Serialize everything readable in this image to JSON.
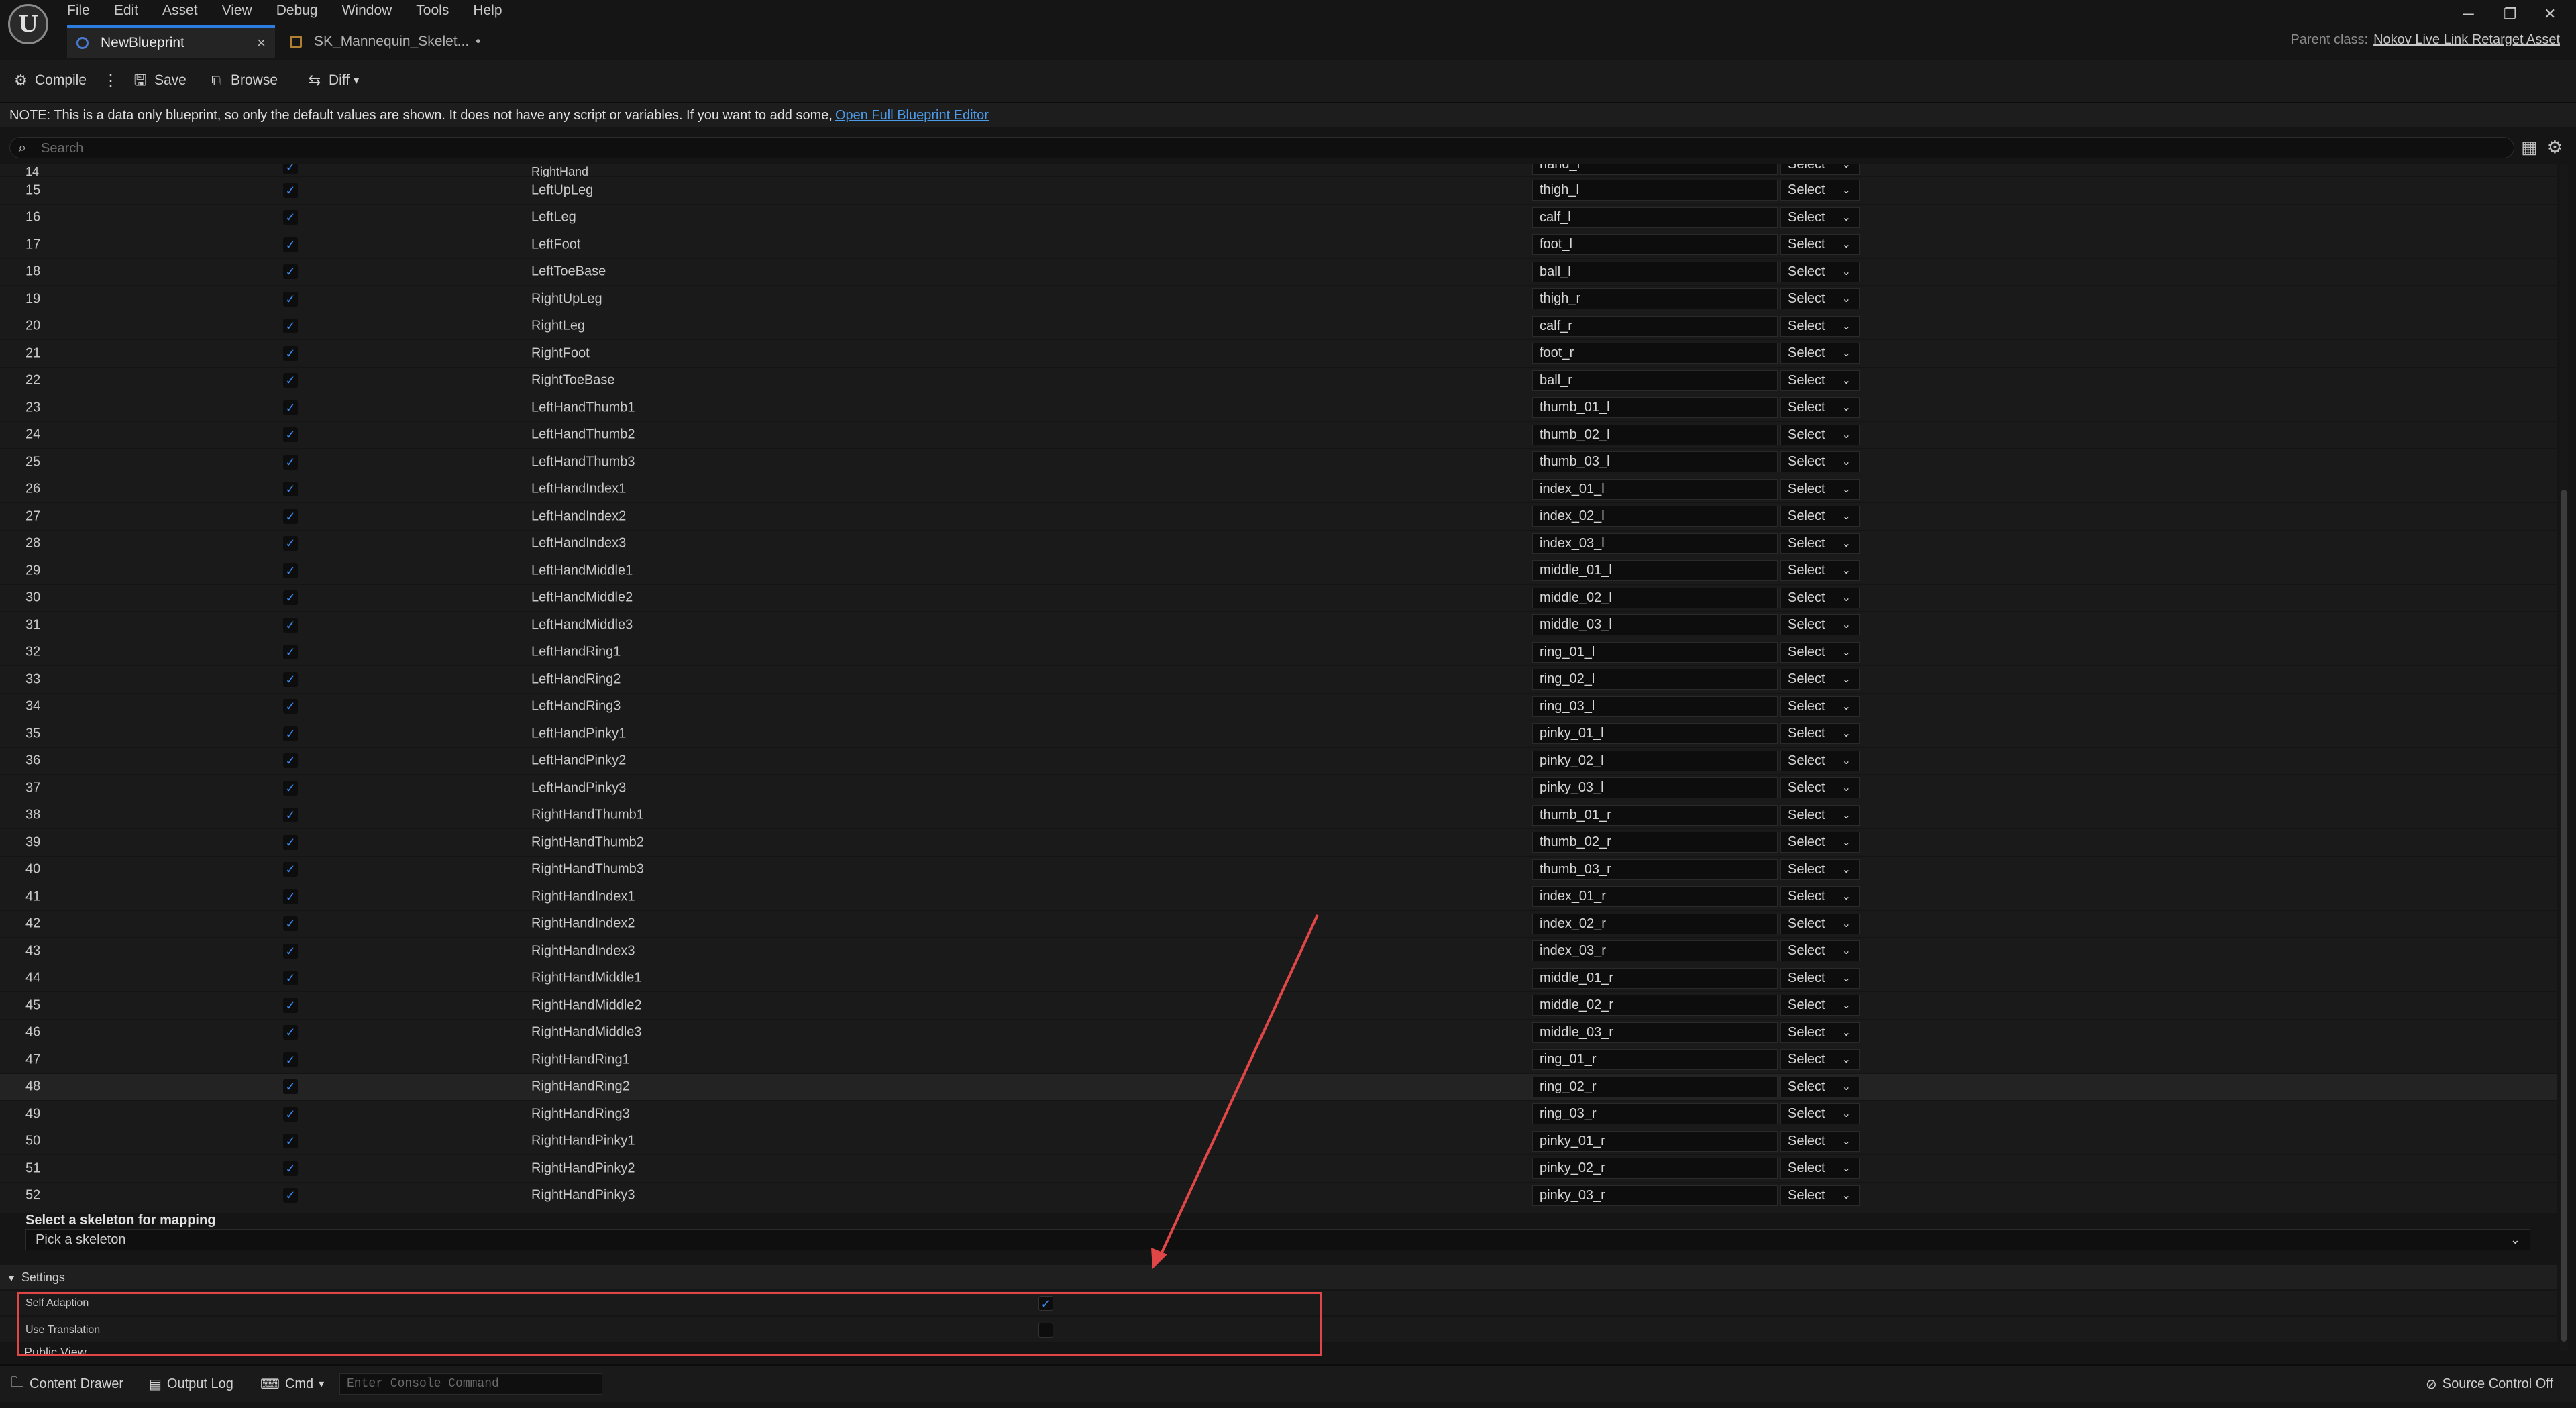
{
  "menu": [
    "File",
    "Edit",
    "Asset",
    "View",
    "Debug",
    "Window",
    "Tools",
    "Help"
  ],
  "tabs": {
    "active": "NewBlueprint",
    "close": "×",
    "second": "SK_Mannequin_Skelet...",
    "second_dirty": "•"
  },
  "parent_class": {
    "label": "Parent class:",
    "value": "Nokov Live Link Retarget Asset"
  },
  "window_controls": {
    "minimize": "─",
    "restore": "❐",
    "close": "✕"
  },
  "toolbar": {
    "compile": "Compile",
    "save": "Save",
    "browse": "Browse",
    "diff": "Diff"
  },
  "note": {
    "text": "NOTE: This is a data only blueprint, so only the default values are shown.  It does not have any script or variables.  If you want to add some,",
    "link": "Open Full Blueprint Editor"
  },
  "search": {
    "placeholder": "Search"
  },
  "select_label": "Select",
  "rows": [
    {
      "index": "14",
      "bone": "RightHand",
      "mapping": "hand_r",
      "checked": true,
      "partial": true
    },
    {
      "index": "15",
      "bone": "LeftUpLeg",
      "mapping": "thigh_l",
      "checked": true
    },
    {
      "index": "16",
      "bone": "LeftLeg",
      "mapping": "calf_l",
      "checked": true
    },
    {
      "index": "17",
      "bone": "LeftFoot",
      "mapping": "foot_l",
      "checked": true
    },
    {
      "index": "18",
      "bone": "LeftToeBase",
      "mapping": "ball_l",
      "checked": true
    },
    {
      "index": "19",
      "bone": "RightUpLeg",
      "mapping": "thigh_r",
      "checked": true
    },
    {
      "index": "20",
      "bone": "RightLeg",
      "mapping": "calf_r",
      "checked": true
    },
    {
      "index": "21",
      "bone": "RightFoot",
      "mapping": "foot_r",
      "checked": true
    },
    {
      "index": "22",
      "bone": "RightToeBase",
      "mapping": "ball_r",
      "checked": true
    },
    {
      "index": "23",
      "bone": "LeftHandThumb1",
      "mapping": "thumb_01_l",
      "checked": true
    },
    {
      "index": "24",
      "bone": "LeftHandThumb2",
      "mapping": "thumb_02_l",
      "checked": true
    },
    {
      "index": "25",
      "bone": "LeftHandThumb3",
      "mapping": "thumb_03_l",
      "checked": true
    },
    {
      "index": "26",
      "bone": "LeftHandIndex1",
      "mapping": "index_01_l",
      "checked": true
    },
    {
      "index": "27",
      "bone": "LeftHandIndex2",
      "mapping": "index_02_l",
      "checked": true
    },
    {
      "index": "28",
      "bone": "LeftHandIndex3",
      "mapping": "index_03_l",
      "checked": true
    },
    {
      "index": "29",
      "bone": "LeftHandMiddle1",
      "mapping": "middle_01_l",
      "checked": true
    },
    {
      "index": "30",
      "bone": "LeftHandMiddle2",
      "mapping": "middle_02_l",
      "checked": true
    },
    {
      "index": "31",
      "bone": "LeftHandMiddle3",
      "mapping": "middle_03_l",
      "checked": true
    },
    {
      "index": "32",
      "bone": "LeftHandRing1",
      "mapping": "ring_01_l",
      "checked": true
    },
    {
      "index": "33",
      "bone": "LeftHandRing2",
      "mapping": "ring_02_l",
      "checked": true
    },
    {
      "index": "34",
      "bone": "LeftHandRing3",
      "mapping": "ring_03_l",
      "checked": true
    },
    {
      "index": "35",
      "bone": "LeftHandPinky1",
      "mapping": "pinky_01_l",
      "checked": true
    },
    {
      "index": "36",
      "bone": "LeftHandPinky2",
      "mapping": "pinky_02_l",
      "checked": true
    },
    {
      "index": "37",
      "bone": "LeftHandPinky3",
      "mapping": "pinky_03_l",
      "checked": true
    },
    {
      "index": "38",
      "bone": "RightHandThumb1",
      "mapping": "thumb_01_r",
      "checked": true
    },
    {
      "index": "39",
      "bone": "RightHandThumb2",
      "mapping": "thumb_02_r",
      "checked": true
    },
    {
      "index": "40",
      "bone": "RightHandThumb3",
      "mapping": "thumb_03_r",
      "checked": true
    },
    {
      "index": "41",
      "bone": "RightHandIndex1",
      "mapping": "index_01_r",
      "checked": true
    },
    {
      "index": "42",
      "bone": "RightHandIndex2",
      "mapping": "index_02_r",
      "checked": true
    },
    {
      "index": "43",
      "bone": "RightHandIndex3",
      "mapping": "index_03_r",
      "checked": true
    },
    {
      "index": "44",
      "bone": "RightHandMiddle1",
      "mapping": "middle_01_r",
      "checked": true
    },
    {
      "index": "45",
      "bone": "RightHandMiddle2",
      "mapping": "middle_02_r",
      "checked": true
    },
    {
      "index": "46",
      "bone": "RightHandMiddle3",
      "mapping": "middle_03_r",
      "checked": true
    },
    {
      "index": "47",
      "bone": "RightHandRing1",
      "mapping": "ring_01_r",
      "checked": true
    },
    {
      "index": "48",
      "bone": "RightHandRing2",
      "mapping": "ring_02_r",
      "checked": true,
      "highlighted": true
    },
    {
      "index": "49",
      "bone": "RightHandRing3",
      "mapping": "ring_03_r",
      "checked": true
    },
    {
      "index": "50",
      "bone": "RightHandPinky1",
      "mapping": "pinky_01_r",
      "checked": true
    },
    {
      "index": "51",
      "bone": "RightHandPinky2",
      "mapping": "pinky_02_r",
      "checked": true
    },
    {
      "index": "52",
      "bone": "RightHandPinky3",
      "mapping": "pinky_03_r",
      "checked": true
    }
  ],
  "skeleton": {
    "label": "Select a skeleton for mapping",
    "value": "Pick a skeleton"
  },
  "settings": {
    "title": "Settings",
    "self_adaption": {
      "label": "Self Adaption",
      "checked": true
    },
    "use_translation": {
      "label": "Use Translation",
      "checked": false
    }
  },
  "public_view": "Public View",
  "bottom": {
    "content_drawer": "Content Drawer",
    "output_log": "Output Log",
    "cmd": "Cmd",
    "console_placeholder": "Enter Console Command",
    "source_control": "Source Control Off"
  },
  "colors": {
    "accent": "#2d7de0",
    "link": "#4c9be8",
    "annotation": "#e04646",
    "checkbox": "#3b8bf2"
  },
  "icons": [
    "unreal-logo-icon",
    "compile-icon",
    "save-icon",
    "browse-icon",
    "diff-icon",
    "search-icon",
    "grid-view-icon",
    "settings-icon",
    "content-drawer-icon",
    "output-log-icon",
    "cmd-icon",
    "source-control-icon"
  ]
}
